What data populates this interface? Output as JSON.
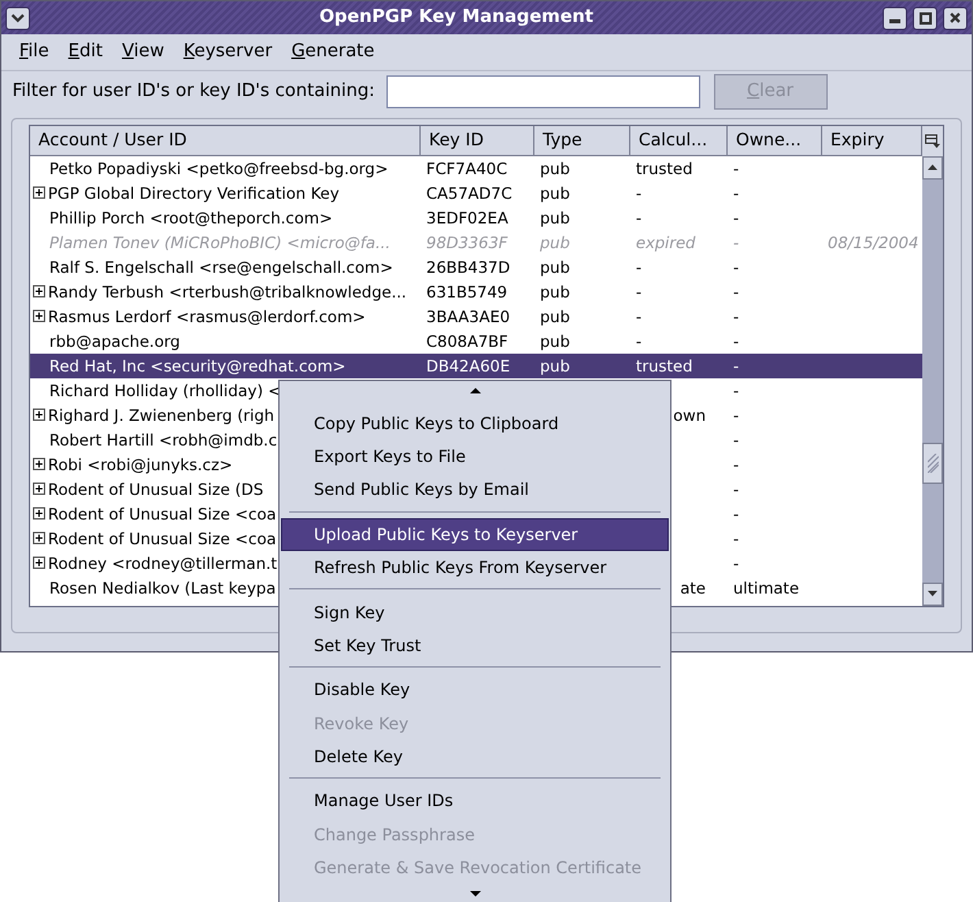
{
  "window": {
    "title": "OpenPGP Key Management"
  },
  "menu_bar": [
    "File",
    "Edit",
    "View",
    "Keyserver",
    "Generate"
  ],
  "filter": {
    "label": "Filter for user ID's or key ID's containing:"
  },
  "clear_button": {
    "label": "Clear",
    "disabled": true
  },
  "table": {
    "columns": [
      "Account / User ID",
      "Key ID",
      "Type",
      "Calcul...",
      "Owne...",
      "Expiry"
    ],
    "rows": [
      {
        "account": "Petko Popadiyski <petko@freebsd-bg.org>",
        "expandable": false,
        "key_id": "FCF7A40C",
        "type": "pub",
        "calculated": "trusted",
        "owner": "-",
        "expired": false,
        "selected": false
      },
      {
        "account": "PGP Global Directory Verification Key",
        "expandable": true,
        "key_id": "CA57AD7C",
        "type": "pub",
        "calculated": "-",
        "owner": "-",
        "expired": false,
        "selected": false
      },
      {
        "account": "Phillip Porch <root@theporch.com>",
        "expandable": false,
        "key_id": "3EDF02EA",
        "type": "pub",
        "calculated": "-",
        "owner": "-",
        "expired": false,
        "selected": false
      },
      {
        "account": "Plamen Tonev (MiCRoPhoBIC) <micro@fa...",
        "expandable": false,
        "key_id": "98D3363F",
        "type": "pub",
        "calculated": "expired",
        "owner": "-",
        "expiry": "08/15/2004",
        "expired": true,
        "selected": false
      },
      {
        "account": "Ralf S. Engelschall <rse@engelschall.com>",
        "expandable": false,
        "key_id": "26BB437D",
        "type": "pub",
        "calculated": "-",
        "owner": "-",
        "expired": false,
        "selected": false
      },
      {
        "account": "Randy Terbush <rterbush@tribalknowledge...",
        "expandable": true,
        "key_id": "631B5749",
        "type": "pub",
        "calculated": "-",
        "owner": "-",
        "expired": false,
        "selected": false
      },
      {
        "account": "Rasmus Lerdorf <rasmus@lerdorf.com>",
        "expandable": true,
        "key_id": "3BAA3AE0",
        "type": "pub",
        "calculated": "-",
        "owner": "-",
        "expired": false,
        "selected": false
      },
      {
        "account": "rbb@apache.org",
        "expandable": false,
        "key_id": "C808A7BF",
        "type": "pub",
        "calculated": "-",
        "owner": "-",
        "expired": false,
        "selected": false
      },
      {
        "account": "Red Hat, Inc <security@redhat.com>",
        "expandable": false,
        "key_id": "DB42A60E",
        "type": "pub",
        "calculated": "trusted",
        "owner": "-",
        "expired": false,
        "selected": true
      },
      {
        "account": "Richard Holliday (rholliday) <",
        "expandable": false,
        "owner": "-",
        "expired": false,
        "selected": false
      },
      {
        "account": "Righard J. Zwienenberg (righ",
        "expandable": true,
        "calculated": "own",
        "owner": "-",
        "expired": false,
        "selected": false
      },
      {
        "account": "Robert Hartill <robh@imdb.c",
        "expandable": false,
        "owner": "-",
        "expired": false,
        "selected": false
      },
      {
        "account": "Robi <robi@junyks.cz>",
        "expandable": true,
        "owner": "-",
        "expired": false,
        "selected": false
      },
      {
        "account": "Rodent of Unusual Size (DS",
        "expandable": true,
        "owner": "-",
        "expired": false,
        "selected": false
      },
      {
        "account": "Rodent of Unusual Size <coa",
        "expandable": true,
        "owner": "-",
        "expired": false,
        "selected": false
      },
      {
        "account": "Rodent of Unusual Size <coa",
        "expandable": true,
        "owner": "-",
        "expired": false,
        "selected": false
      },
      {
        "account": "Rodney <rodney@tillerman.t",
        "expandable": true,
        "owner": "-",
        "expired": false,
        "selected": false
      },
      {
        "account": "Rosen Nedialkov (Last keypa",
        "expandable": false,
        "calculated": "ate",
        "owner": "ultimate",
        "expired": false,
        "selected": false
      }
    ]
  },
  "context_menu": {
    "items": [
      {
        "kind": "item",
        "label": "Copy Public Keys to Clipboard",
        "selected": false,
        "disabled": false
      },
      {
        "kind": "item",
        "label": "Export Keys to File",
        "selected": false,
        "disabled": false
      },
      {
        "kind": "item",
        "label": "Send Public Keys by Email",
        "selected": false,
        "disabled": false
      },
      {
        "kind": "separator"
      },
      {
        "kind": "item",
        "label": "Upload Public Keys to Keyserver",
        "selected": true,
        "disabled": false
      },
      {
        "kind": "item",
        "label": "Refresh Public Keys From Keyserver",
        "selected": false,
        "disabled": false
      },
      {
        "kind": "separator"
      },
      {
        "kind": "item",
        "label": "Sign Key",
        "selected": false,
        "disabled": false
      },
      {
        "kind": "item",
        "label": "Set Key Trust",
        "selected": false,
        "disabled": false
      },
      {
        "kind": "separator"
      },
      {
        "kind": "item",
        "label": "Disable Key",
        "selected": false,
        "disabled": false
      },
      {
        "kind": "item",
        "label": "Revoke Key",
        "selected": false,
        "disabled": true
      },
      {
        "kind": "item",
        "label": "Delete Key",
        "selected": false,
        "disabled": false
      },
      {
        "kind": "separator"
      },
      {
        "kind": "item",
        "label": "Manage User IDs",
        "selected": false,
        "disabled": false
      },
      {
        "kind": "item",
        "label": "Change Passphrase",
        "selected": false,
        "disabled": true
      },
      {
        "kind": "item",
        "label": "Generate & Save Revocation Certificate",
        "selected": false,
        "disabled": true
      }
    ]
  }
}
